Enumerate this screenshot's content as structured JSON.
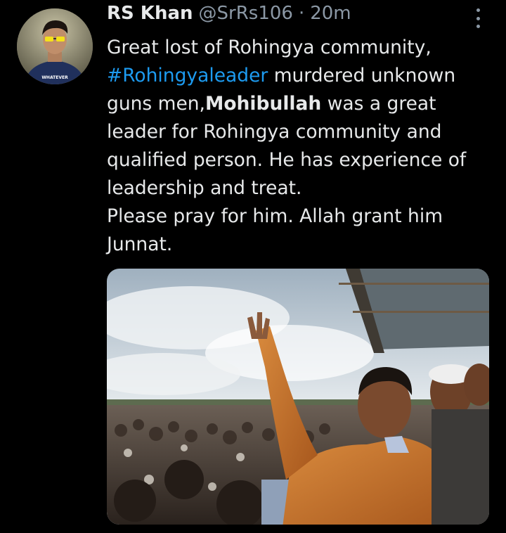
{
  "tweet": {
    "author_name": "RS Khan",
    "handle": "@SrRs106",
    "separator": "·",
    "time": "20m",
    "avatar_text": "WHATEVER",
    "text": {
      "line1": "Great lost of Rohingya community,",
      "hashtag": "#Rohingyaleader",
      "line2_rest": " murdered unknown",
      "line3_start": "guns men,",
      "bold_name": "Mohibullah",
      "line3_rest": " was a great",
      "line4": "leader for Rohingya community and",
      "line5": "qualified person. He has experience of",
      "line6": "leadership and treat.",
      "line7": "Please pray for him. Allah grant him",
      "line8": "Junnat."
    }
  },
  "colors": {
    "background": "#000000",
    "text": "#e7e9ea",
    "secondary": "#8b98a5",
    "link": "#1d9bf0"
  },
  "icons": {
    "more": "more-options-icon"
  }
}
